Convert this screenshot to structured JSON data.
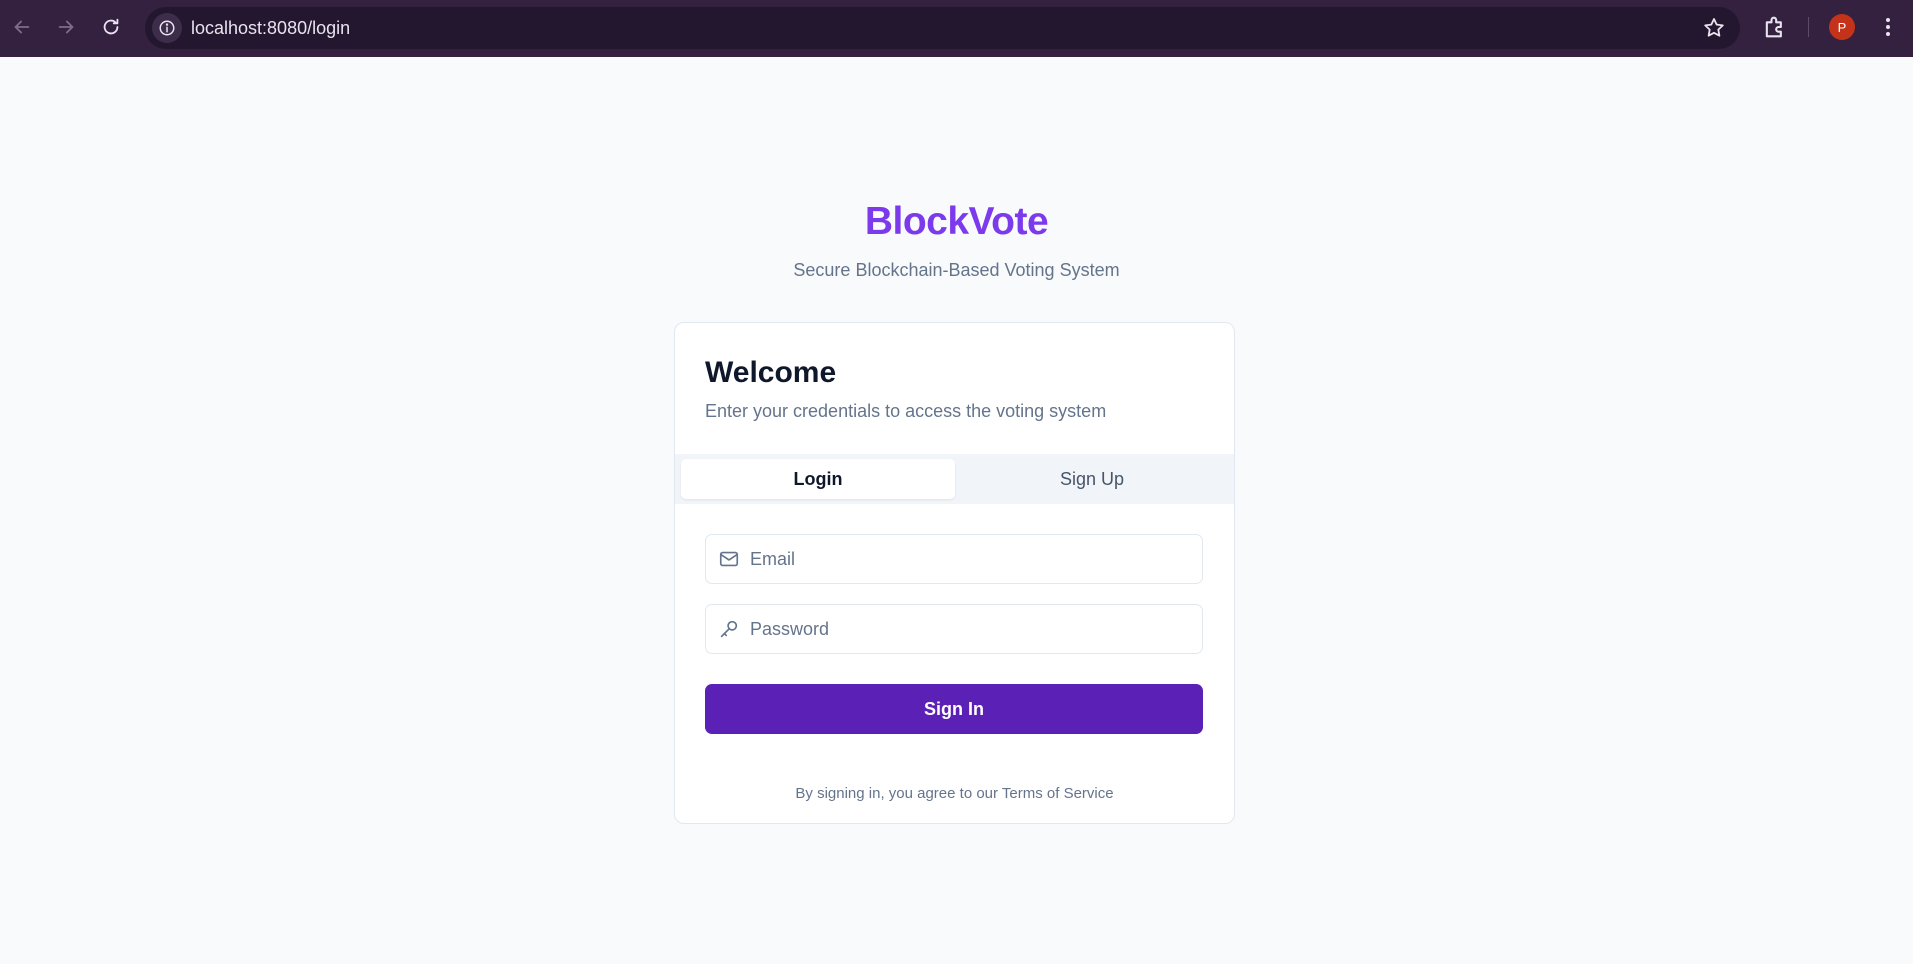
{
  "browser": {
    "url": "localhost:8080/login",
    "profile_initial": "P"
  },
  "brand": {
    "name": "BlockVote",
    "tagline": "Secure Blockchain-Based Voting System",
    "accent_color": "#7c3aed"
  },
  "card": {
    "title": "Welcome",
    "description": "Enter your credentials to access the voting system",
    "tabs": [
      {
        "label": "Login",
        "active": true
      },
      {
        "label": "Sign Up",
        "active": false
      }
    ],
    "email": {
      "placeholder": "Email",
      "value": "",
      "icon": "mail-icon"
    },
    "password": {
      "placeholder": "Password",
      "value": "",
      "icon": "key-icon"
    },
    "submit_label": "Sign In",
    "submit_color": "#5b21b6",
    "terms_text": "By signing in, you agree to our Terms of Service"
  }
}
